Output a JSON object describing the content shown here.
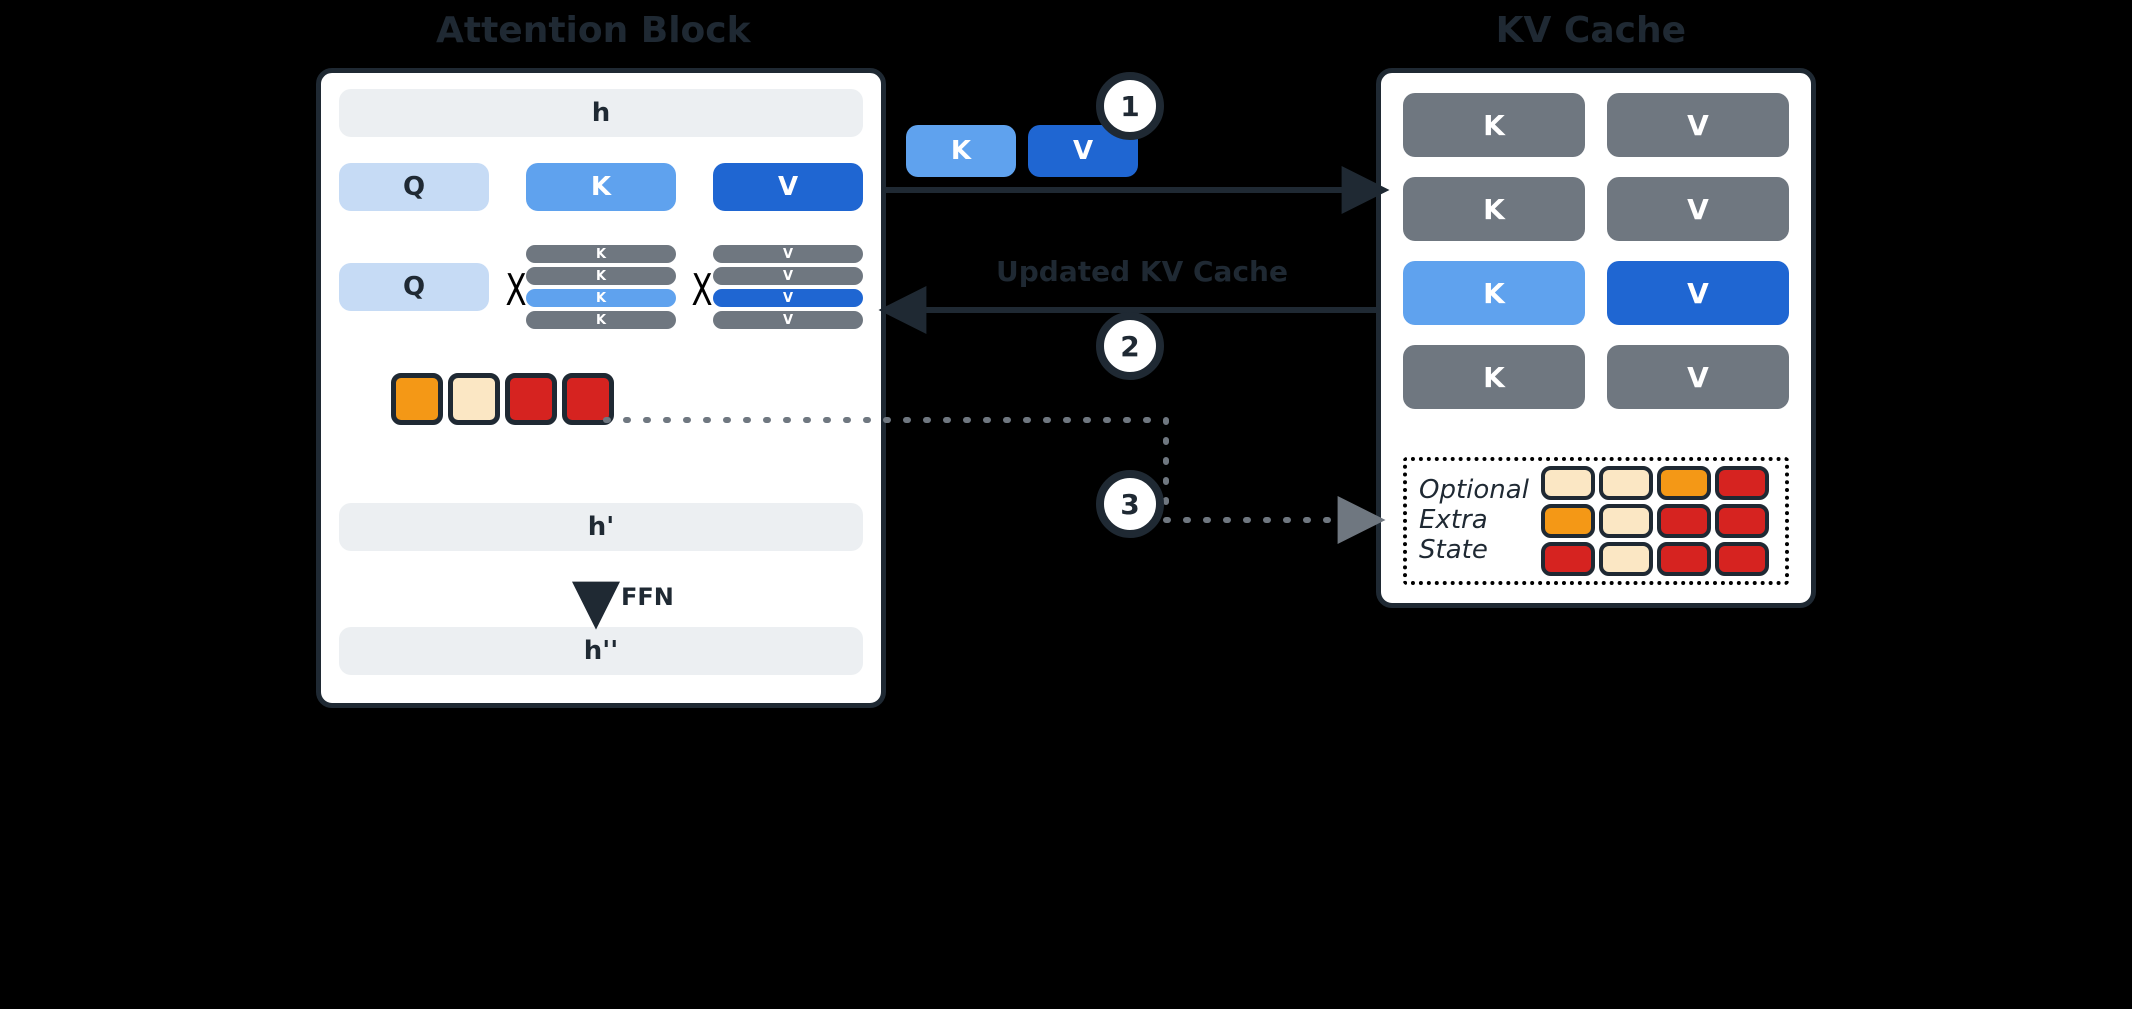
{
  "titles": {
    "attention": "Attention Block",
    "cache": "KV Cache"
  },
  "attn": {
    "h": "h",
    "q": "Q",
    "k": "K",
    "v": "V",
    "h1": "h'",
    "h2": "h''",
    "ffn": "FFN",
    "stack_k": [
      "K",
      "K",
      "K",
      "K"
    ],
    "stack_v": [
      "V",
      "V",
      "V",
      "V"
    ]
  },
  "float": {
    "k": "K",
    "v": "V"
  },
  "mid": {
    "label": "Updated KV Cache"
  },
  "steps": {
    "one": "1",
    "two": "2",
    "three": "3"
  },
  "cache": {
    "rows": [
      {
        "k": "K",
        "v": "V",
        "new": false
      },
      {
        "k": "K",
        "v": "V",
        "new": false
      },
      {
        "k": "K",
        "v": "V",
        "new": true
      },
      {
        "k": "K",
        "v": "V",
        "new": false
      }
    ],
    "extra_label": "Optional\nExtra\nState",
    "extra_grid": [
      [
        "c",
        "c",
        "o",
        "r"
      ],
      [
        "o",
        "c",
        "r",
        "r"
      ],
      [
        "r",
        "c",
        "r",
        "r"
      ]
    ]
  },
  "glyph": {
    "x": "X"
  }
}
